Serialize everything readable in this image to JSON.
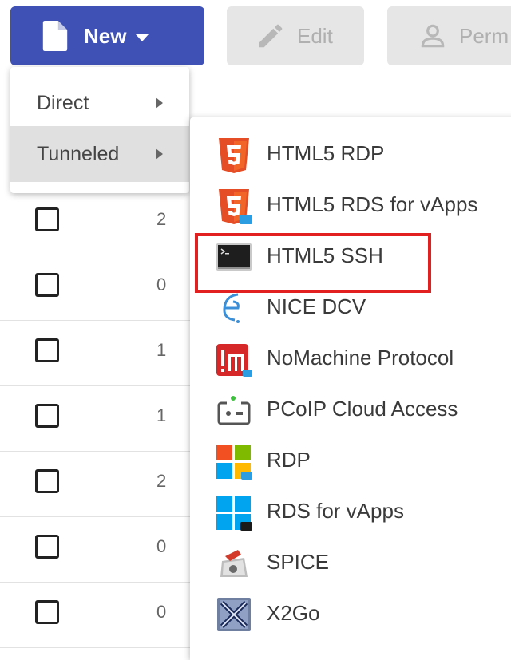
{
  "toolbar": {
    "new_label": "New",
    "edit_label": "Edit",
    "perm_label": "Perm"
  },
  "menu": {
    "items": [
      {
        "label": "Direct"
      },
      {
        "label": "Tunneled"
      }
    ]
  },
  "submenu": {
    "items": [
      {
        "label": "HTML5 RDP",
        "icon": "html5-icon"
      },
      {
        "label": "HTML5 RDS for vApps",
        "icon": "html5-vapps-icon"
      },
      {
        "label": "HTML5 SSH",
        "icon": "terminal-icon"
      },
      {
        "label": "NICE DCV",
        "icon": "nice-dcv-icon"
      },
      {
        "label": "NoMachine Protocol",
        "icon": "nomachine-icon"
      },
      {
        "label": "PCoIP Cloud Access",
        "icon": "pcoip-icon"
      },
      {
        "label": "RDP",
        "icon": "windows-icon"
      },
      {
        "label": "RDS for vApps",
        "icon": "windows-vapps-icon"
      },
      {
        "label": "SPICE",
        "icon": "spice-icon"
      },
      {
        "label": "X2Go",
        "icon": "x2go-icon"
      }
    ]
  },
  "table": {
    "rows": [
      {
        "value": "2"
      },
      {
        "value": "0"
      },
      {
        "value": "1"
      },
      {
        "value": "1"
      },
      {
        "value": "2"
      },
      {
        "value": "0"
      },
      {
        "value": "0"
      }
    ]
  },
  "colors": {
    "primary": "#3f51b5",
    "highlight": "#e32020"
  }
}
